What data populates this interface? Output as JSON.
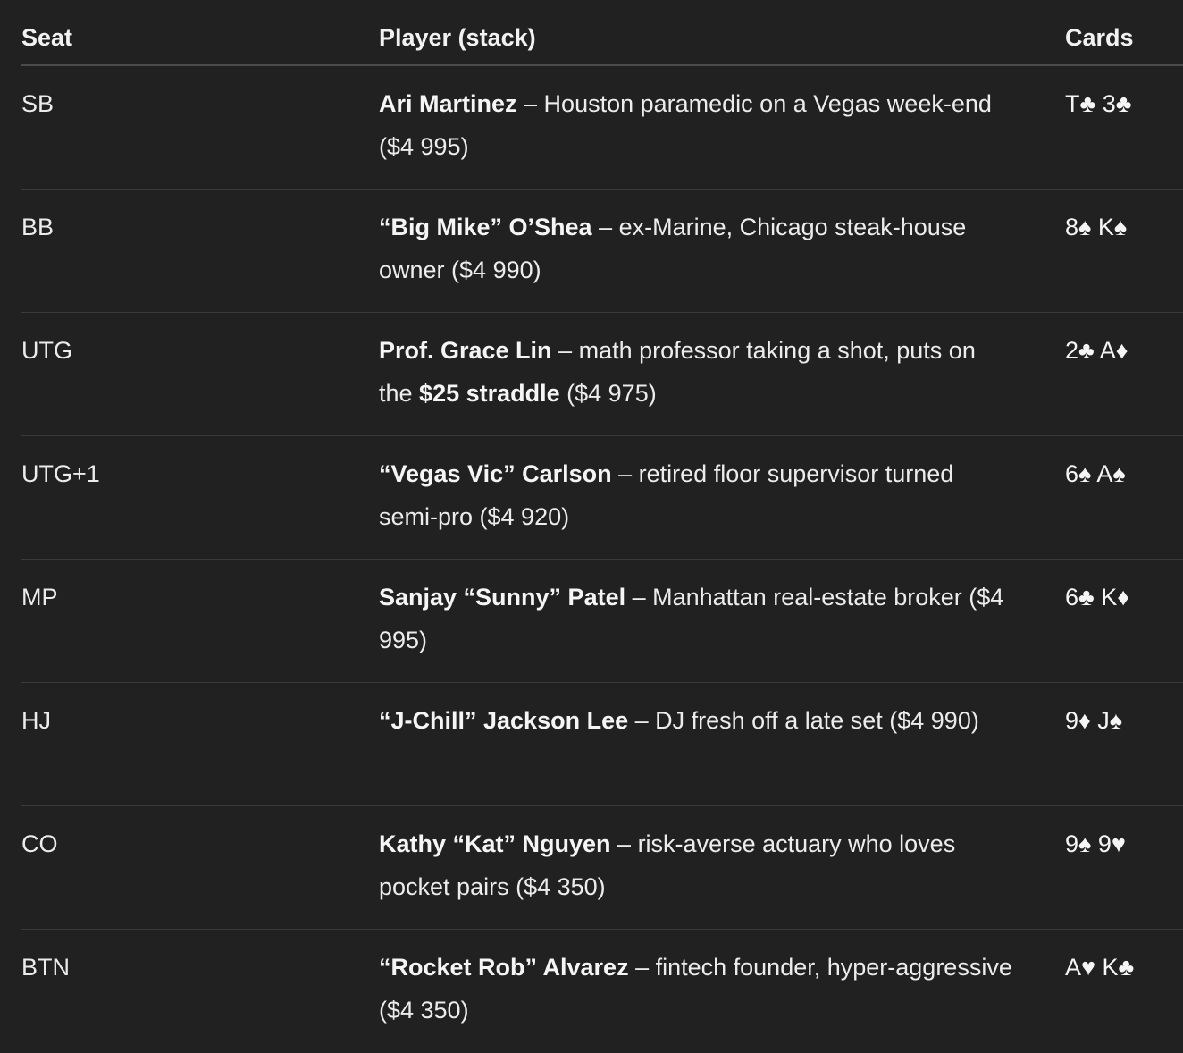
{
  "headers": {
    "seat": "Seat",
    "player": "Player (stack)",
    "cards": "Cards"
  },
  "rows": [
    {
      "seat": "SB",
      "name": "Ari Martinez",
      "desc": " – Houston paramedic on a Vegas week-end ($4 995)",
      "cards": "T♣ 3♣"
    },
    {
      "seat": "BB",
      "name": "“Big Mike” O’Shea",
      "desc": " – ex-Marine, Chicago steak-house owner ($4 990)",
      "cards": "8♠ K♠"
    },
    {
      "seat": "UTG",
      "name": "Prof. Grace Lin",
      "desc": " – math professor taking a shot, puts on the ",
      "emph": "$25 straddle",
      "desc2": " ($4 975)",
      "cards": "2♣ A♦"
    },
    {
      "seat": "UTG+1",
      "name": "“Vegas Vic” Carlson",
      "desc": " – retired floor supervisor turned semi-pro ($4 920)",
      "cards": "6♠ A♠"
    },
    {
      "seat": "MP",
      "name": "Sanjay “Sunny” Patel",
      "desc": " – Manhattan real-estate broker ($4 995)",
      "cards": "6♣ K♦"
    },
    {
      "seat": "HJ",
      "name": "“J-Chill” Jackson Lee",
      "desc": " – DJ fresh off a late set ($4 990)",
      "cards": "9♦ J♠"
    },
    {
      "seat": "CO",
      "name": "Kathy “Kat” Nguyen",
      "desc": " – risk-averse actuary who loves pocket pairs ($4 350)",
      "cards": "9♠ 9♥"
    },
    {
      "seat": "BTN",
      "name": "“Rocket Rob” Alvarez",
      "desc": " – fintech founder, hyper-aggressive ($4 350)",
      "cards": "A♥ K♣"
    }
  ]
}
